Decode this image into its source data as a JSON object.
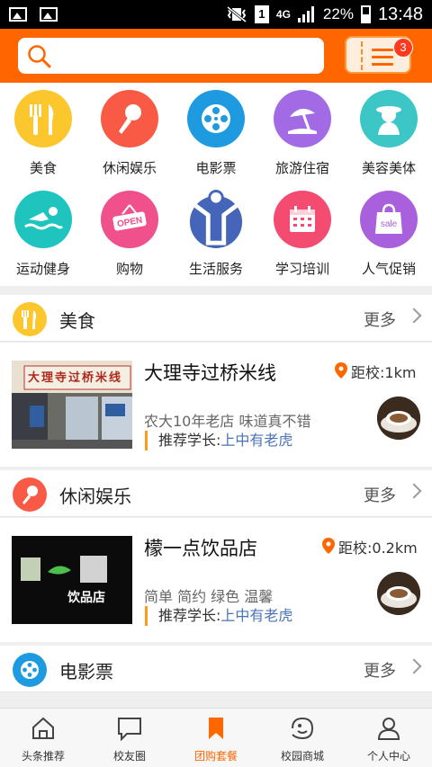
{
  "status_bar": {
    "sim": "1",
    "network": "4G",
    "battery": "22%",
    "time": "13:48"
  },
  "header": {
    "menu_badge": "3"
  },
  "categories": [
    {
      "label": "美食",
      "color": "#fcc72c",
      "icon": "fork-knife-icon"
    },
    {
      "label": "休闲娱乐",
      "color": "#f85a46",
      "icon": "microphone-icon"
    },
    {
      "label": "电影票",
      "color": "#1e9be0",
      "icon": "film-reel-icon"
    },
    {
      "label": "旅游住宿",
      "color": "#a36ae6",
      "icon": "beach-umbrella-icon"
    },
    {
      "label": "美容美体",
      "color": "#3cc6c6",
      "icon": "lady-icon"
    },
    {
      "label": "运动健身",
      "color": "#1fc4bf",
      "icon": "swimmer-icon"
    },
    {
      "label": "购物",
      "color": "#f0508c",
      "icon": "open-sign-icon"
    },
    {
      "label": "生活服务",
      "color": "#4566b8",
      "icon": "person-arms-up-icon"
    },
    {
      "label": "学习培训",
      "color": "#f44b70",
      "icon": "calendar-icon"
    },
    {
      "label": "人气促销",
      "color": "#a860dc",
      "icon": "sale-bag-icon"
    }
  ],
  "sections": [
    {
      "title": "美食",
      "more": "更多",
      "color": "#fcc72c",
      "item": {
        "name": "大理寺过桥米线",
        "distance": "距校:1km",
        "description": "农大10年老店 味道真不错",
        "recommend_label": "推荐学长:",
        "recommend_user": "上中有老虎",
        "sign_text": "大理寺过桥米线"
      }
    },
    {
      "title": "休闲娱乐",
      "more": "更多",
      "color": "#f85a46",
      "item": {
        "name": "檬一点饮品店",
        "distance": "距校:0.2km",
        "description": "简单 简约 绿色 温馨",
        "recommend_label": "推荐学长:",
        "recommend_user": "上中有老虎",
        "sign_text": "饮品店"
      }
    },
    {
      "title": "电影票",
      "more": "更多",
      "color": "#1e9be0"
    }
  ],
  "bottom_nav": [
    {
      "label": "头条推荐",
      "icon": "home-icon",
      "active": false
    },
    {
      "label": "校友圈",
      "icon": "chat-bubble-icon",
      "active": false
    },
    {
      "label": "团购套餐",
      "icon": "bookmark-icon",
      "active": true
    },
    {
      "label": "校园商城",
      "icon": "shop-face-icon",
      "active": false
    },
    {
      "label": "个人中心",
      "icon": "person-icon",
      "active": false
    }
  ]
}
